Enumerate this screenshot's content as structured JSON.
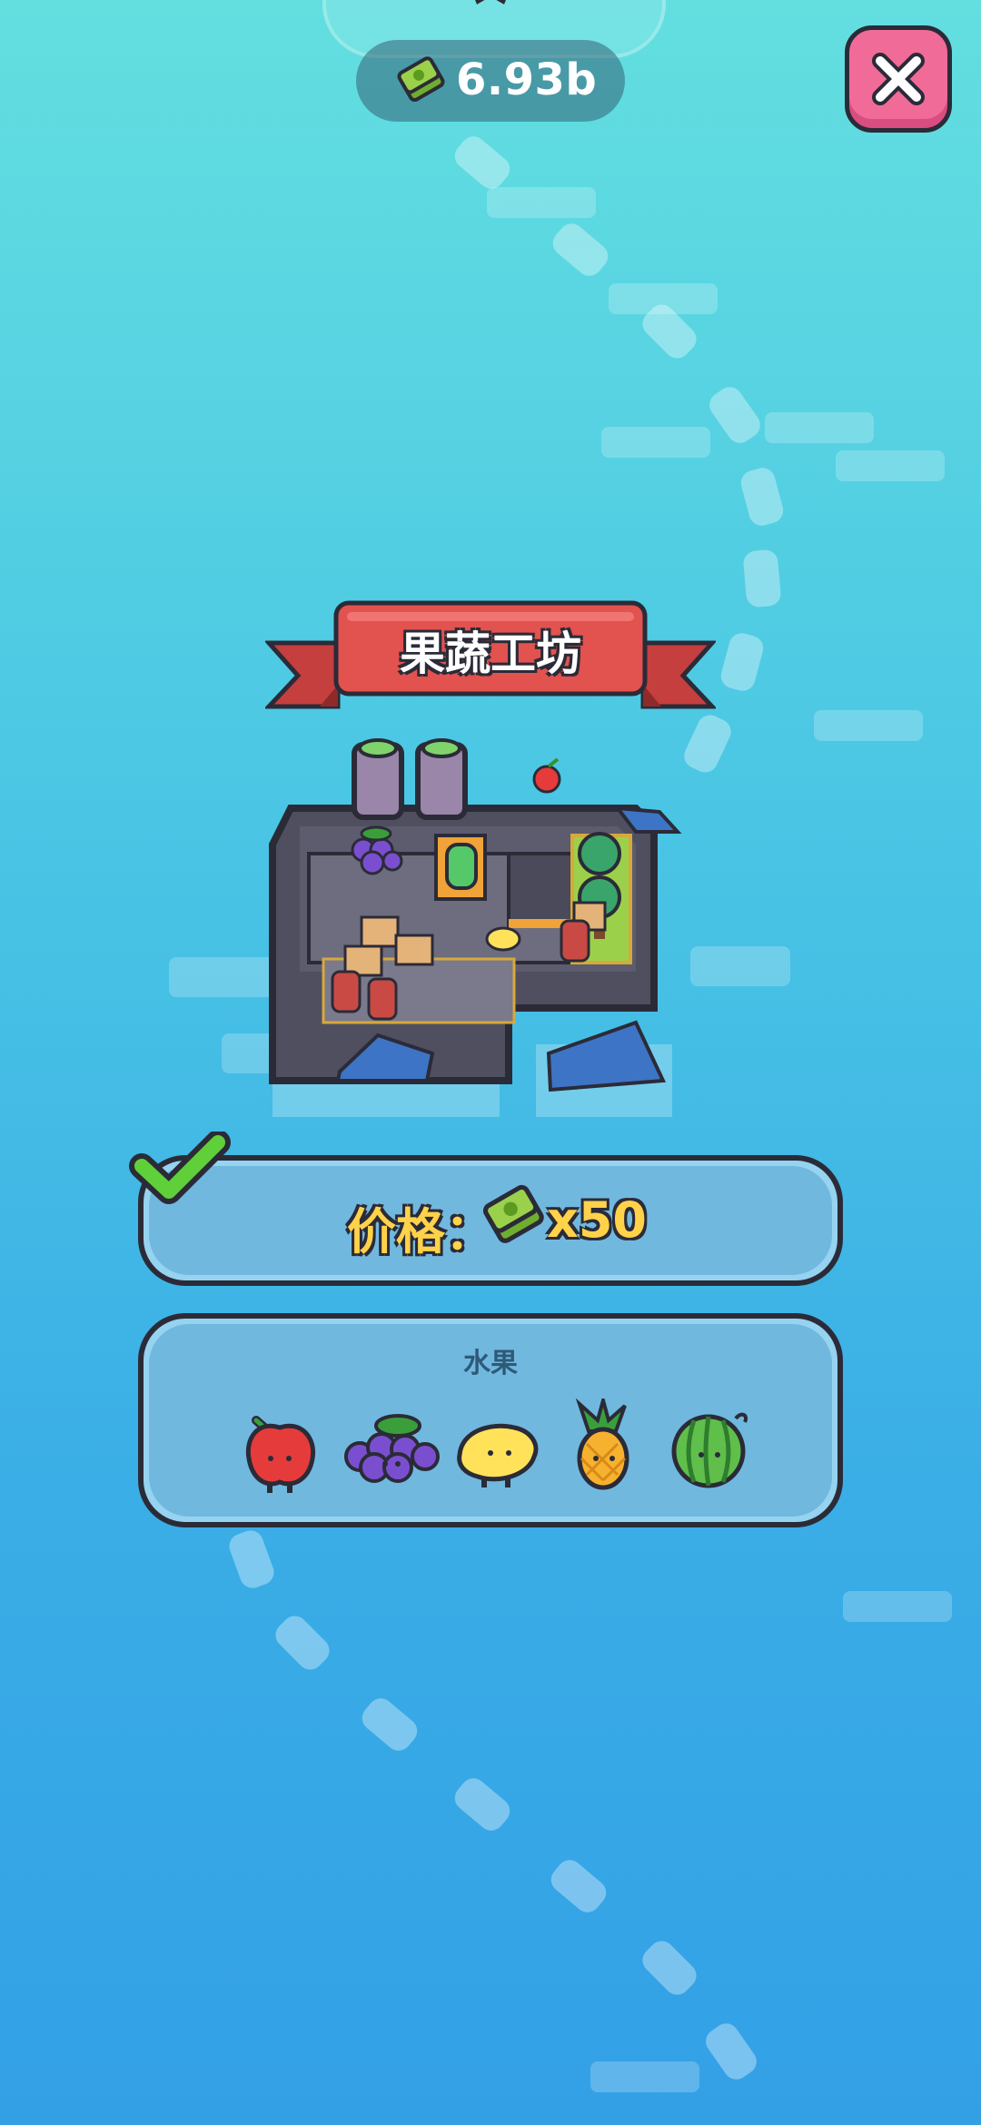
{
  "hud": {
    "currency_icon": "cash-stack-icon",
    "currency_amount": "6.93b",
    "close_icon": "close-x-icon"
  },
  "building": {
    "title": "果蔬工坊",
    "icon": "fruit-veg-factory-building"
  },
  "price": {
    "label": "价格：",
    "currency_icon": "cash-stack-icon",
    "quantity": "x50",
    "purchased_icon": "green-checkmark-icon"
  },
  "products": {
    "title": "水果",
    "items": [
      {
        "name": "apple",
        "icon": "apple-icon"
      },
      {
        "name": "grape",
        "icon": "grape-icon"
      },
      {
        "name": "lemon",
        "icon": "lemon-icon"
      },
      {
        "name": "pineapple",
        "icon": "pineapple-icon"
      },
      {
        "name": "watermelon",
        "icon": "watermelon-icon"
      }
    ]
  },
  "colors": {
    "close_button": "#f06b98",
    "price_text": "#ffd24a",
    "banner_red": "#e2524f",
    "outline": "#2b2b38"
  }
}
